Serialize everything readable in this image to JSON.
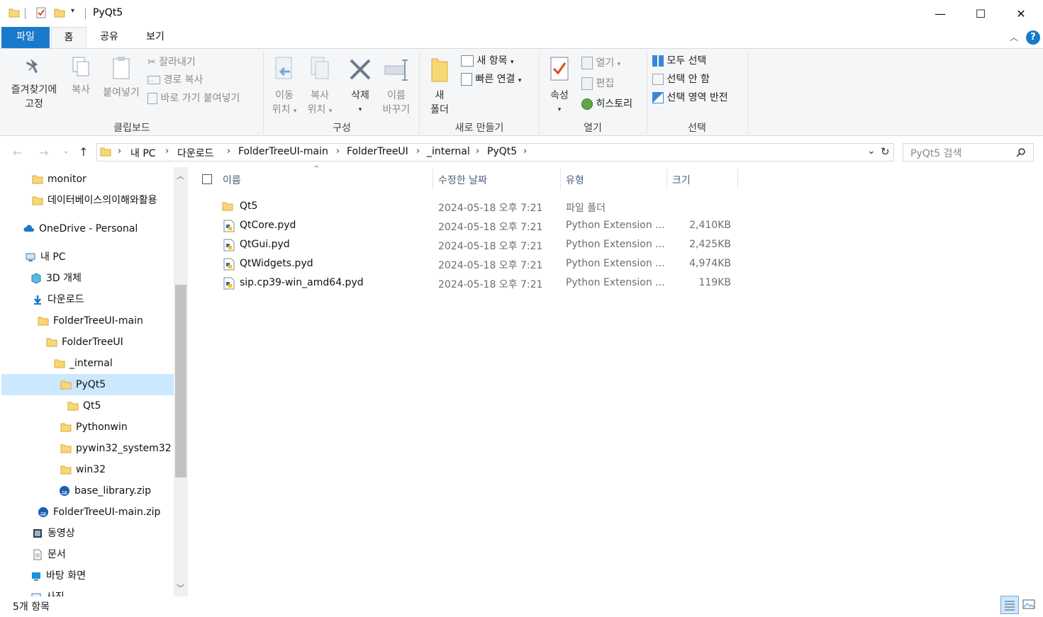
{
  "window": {
    "title": "PyQt5",
    "controls": {
      "minimize": "—",
      "maximize": "☐",
      "close": "✕"
    }
  },
  "ribbon_tabs": [
    {
      "label": "파일"
    },
    {
      "label": "홈"
    },
    {
      "label": "공유"
    },
    {
      "label": "보기"
    }
  ],
  "ribbon": {
    "clipboard": {
      "pin": "즐겨찾기에",
      "pin2": "고정",
      "copy": "복사",
      "paste": "붙여넣기",
      "cut": "잘라내기",
      "copy_path": "경로 복사",
      "paste_shortcut": "바로 가기 붙여넣기",
      "label": "클립보드"
    },
    "organize": {
      "move_to": "이동",
      "move_to2": "위치",
      "copy_to": "복사",
      "copy_to2": "위치",
      "delete": "삭제",
      "rename": "이름",
      "rename2": "바꾸기",
      "label": "구성"
    },
    "new": {
      "new_folder": "새",
      "new_folder2": "폴더",
      "new_item": "새 항목",
      "easy_access": "빠른 연결",
      "label": "새로 만들기"
    },
    "open": {
      "properties": "속성",
      "open": "열기",
      "edit": "편집",
      "history": "히스토리",
      "label": "열기"
    },
    "select": {
      "select_all": "모두 선택",
      "select_none": "선택 안 함",
      "invert": "선택 영역 반전",
      "label": "선택"
    }
  },
  "address": {
    "crumbs": [
      "내 PC",
      "다운로드",
      "FolderTreeUI-main",
      "FolderTreeUI",
      "_internal",
      "PyQt5"
    ],
    "search_placeholder": "PyQt5 검색"
  },
  "nav": [
    {
      "label": "monitor",
      "icon": "folder-icon"
    },
    {
      "label": "데이터베이스의이해와활용",
      "icon": "folder-icon"
    },
    {
      "label": "OneDrive - Personal",
      "icon": "cloud-icon"
    },
    {
      "label": "내 PC",
      "icon": "pc-icon"
    },
    {
      "label": "3D 개체",
      "icon": "cube-icon"
    },
    {
      "label": "다운로드",
      "icon": "download-icon"
    },
    {
      "label": "FolderTreeUI-main",
      "icon": "folder-icon"
    },
    {
      "label": "FolderTreeUI",
      "icon": "folder-icon"
    },
    {
      "label": "_internal",
      "icon": "folder-icon"
    },
    {
      "label": "PyQt5",
      "icon": "folder-icon"
    },
    {
      "label": "Qt5",
      "icon": "folder-icon"
    },
    {
      "label": "Pythonwin",
      "icon": "folder-icon"
    },
    {
      "label": "pywin32_system32",
      "icon": "folder-icon"
    },
    {
      "label": "win32",
      "icon": "folder-icon"
    },
    {
      "label": "base_library.zip",
      "icon": "zip-icon"
    },
    {
      "label": "FolderTreeUI-main.zip",
      "icon": "zip-icon"
    },
    {
      "label": "동영상",
      "icon": "video-icon"
    },
    {
      "label": "문서",
      "icon": "document-icon"
    },
    {
      "label": "바탕 화면",
      "icon": "desktop-icon"
    },
    {
      "label": "사진",
      "icon": "pictures-icon"
    }
  ],
  "columns": {
    "name": "이름",
    "date": "수정한 날짜",
    "type": "유형",
    "size": "크기"
  },
  "files": [
    {
      "name": "Qt5",
      "date": "2024-05-18 오후 7:21",
      "type": "파일 폴더",
      "size": "",
      "icon": "folder-icon"
    },
    {
      "name": "QtCore.pyd",
      "date": "2024-05-18 오후 7:21",
      "type": "Python Extension ...",
      "size": "2,410KB",
      "icon": "python-file-icon"
    },
    {
      "name": "QtGui.pyd",
      "date": "2024-05-18 오후 7:21",
      "type": "Python Extension ...",
      "size": "2,425KB",
      "icon": "python-file-icon"
    },
    {
      "name": "QtWidgets.pyd",
      "date": "2024-05-18 오후 7:21",
      "type": "Python Extension ...",
      "size": "4,974KB",
      "icon": "python-file-icon"
    },
    {
      "name": "sip.cp39-win_amd64.pyd",
      "date": "2024-05-18 오후 7:21",
      "type": "Python Extension ...",
      "size": "119KB",
      "icon": "python-file-icon"
    }
  ],
  "status": {
    "count": "5개 항목"
  },
  "colors": {
    "accent": "#1979ca",
    "selection": "#cce8ff",
    "folder": "#f8d775"
  }
}
